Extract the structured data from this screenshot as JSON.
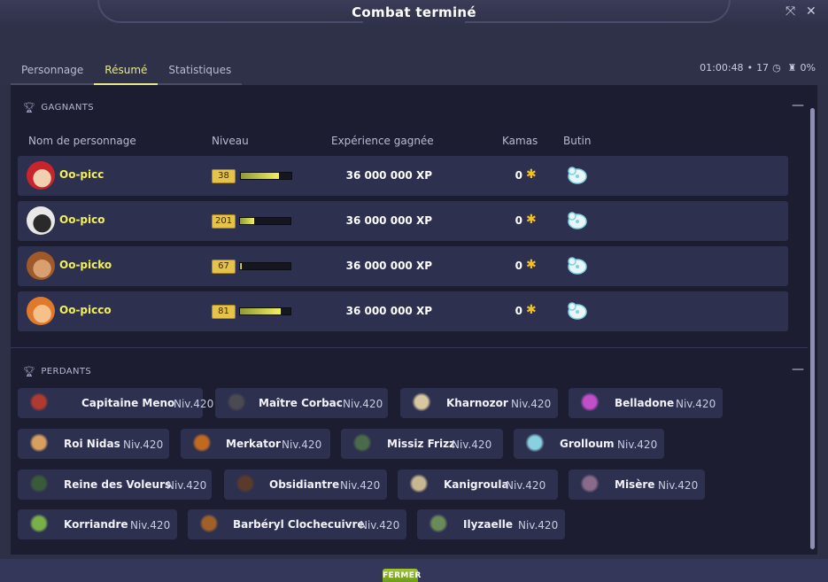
{
  "window": {
    "title": "Combat terminé"
  },
  "tabs": [
    {
      "label": "Personnage",
      "active": false
    },
    {
      "label": "Résumé",
      "active": true
    },
    {
      "label": "Statistiques",
      "active": false
    }
  ],
  "stats": {
    "duration": "01:00:48",
    "separator": "•",
    "turns": "17",
    "percent": "0%"
  },
  "winners": {
    "title": "GAGNANTS",
    "columns": {
      "name": "Nom de personnage",
      "level": "Niveau",
      "xp": "Expérience gagnée",
      "kamas": "Kamas",
      "loot": "Butin"
    },
    "rows": [
      {
        "name": "Oo-picc",
        "level": "38",
        "xp_progress": 0.75,
        "xp": "36 000 000 XP",
        "kamas": "0"
      },
      {
        "name": "Oo-pico",
        "level": "201",
        "xp_progress": 0.28,
        "xp": "36 000 000 XP",
        "kamas": "0"
      },
      {
        "name": "Oo-picko",
        "level": "67",
        "xp_progress": 0.04,
        "xp": "36 000 000 XP",
        "kamas": "0"
      },
      {
        "name": "Oo-picco",
        "level": "81",
        "xp_progress": 0.8,
        "xp": "36 000 000 XP",
        "kamas": "0"
      }
    ]
  },
  "losers": {
    "title": "PERDANTS",
    "items": [
      {
        "name": "Capitaine Meno",
        "level": "Niv.420"
      },
      {
        "name": "Maître Corbac",
        "level": "Niv.420"
      },
      {
        "name": "Kharnozor",
        "level": "Niv.420"
      },
      {
        "name": "Belladone",
        "level": "Niv.420"
      },
      {
        "name": "Roi Nidas",
        "level": "Niv.420"
      },
      {
        "name": "Merkator",
        "level": "Niv.420"
      },
      {
        "name": "Missiz Frizz",
        "level": "Niv.420"
      },
      {
        "name": "Grolloum",
        "level": "Niv.420"
      },
      {
        "name": "Reine des Voleurs",
        "level": "Niv.420"
      },
      {
        "name": "Obsidiantre",
        "level": "Niv.420"
      },
      {
        "name": "Kanigroula",
        "level": "Niv.420"
      },
      {
        "name": "Misère",
        "level": "Niv.420"
      },
      {
        "name": "Korriandre",
        "level": "Niv.420"
      },
      {
        "name": "Barbéryl Clochecuivre",
        "level": "Niv.420"
      },
      {
        "name": "Ilyzaelle",
        "level": "Niv.420"
      }
    ]
  },
  "footer": {
    "close_label": "FERMER"
  },
  "icons": {
    "kamas": "kamas-coin-icon",
    "loot": "loot-bag-icon",
    "trophy": "trophy-icon",
    "timer": "timer-icon",
    "collapse": "minus-icon"
  },
  "colors": {
    "accent": "#e6e98a",
    "player_name": "#f2f05a",
    "kamas": "#f2c11e",
    "close_button": "#8bb42c"
  }
}
